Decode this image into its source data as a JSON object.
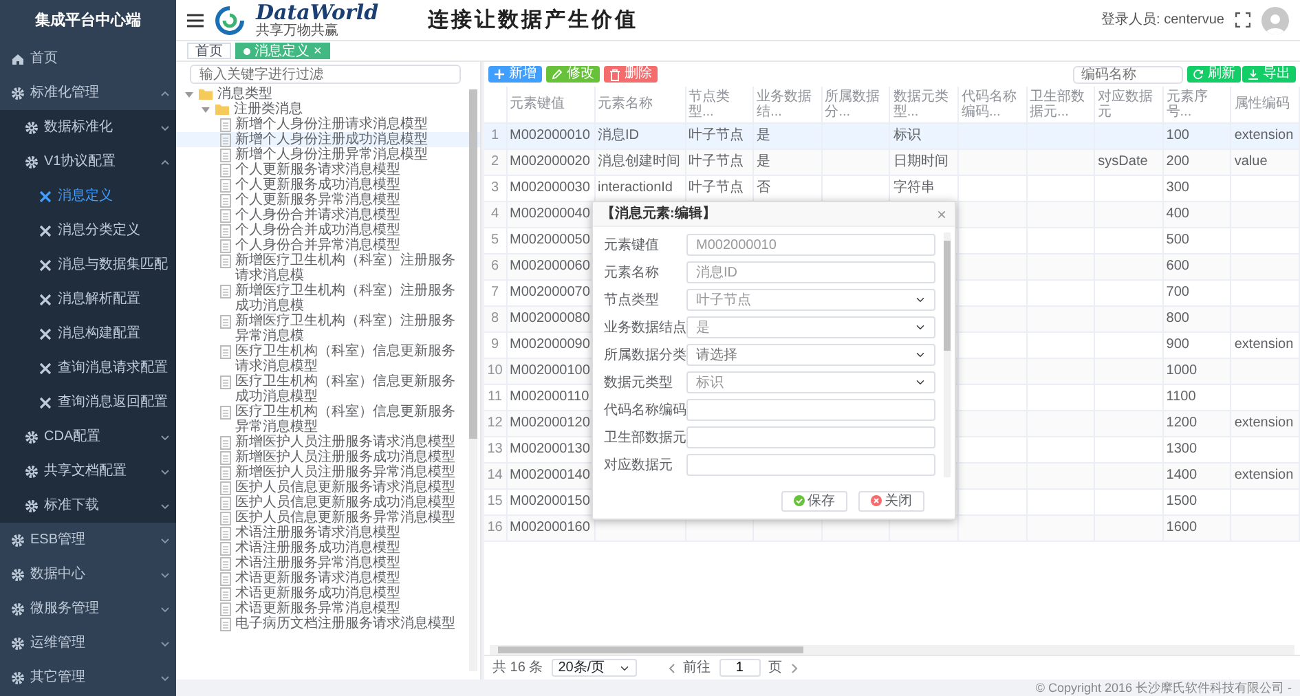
{
  "sidebar": {
    "title": "集成平台中心端",
    "items": [
      {
        "label": "首页",
        "kind": "home",
        "selected": false
      },
      {
        "label": "标准化管理",
        "kind": "group",
        "selected": false,
        "expanded": true,
        "children": [
          {
            "label": "数据标准化",
            "kind": "group",
            "selected": false,
            "expanded": false
          },
          {
            "label": "V1协议配置",
            "kind": "group",
            "selected": false,
            "expanded": true,
            "children": [
              {
                "label": "消息定义",
                "kind": "page",
                "selected": true
              },
              {
                "label": "消息分类定义",
                "kind": "page",
                "selected": false
              },
              {
                "label": "消息与数据集匹配",
                "kind": "page",
                "selected": false
              },
              {
                "label": "消息解析配置",
                "kind": "page",
                "selected": false
              },
              {
                "label": "消息构建配置",
                "kind": "page",
                "selected": false
              },
              {
                "label": "查询消息请求配置",
                "kind": "page",
                "selected": false
              },
              {
                "label": "查询消息返回配置",
                "kind": "page",
                "selected": false
              }
            ]
          },
          {
            "label": "CDA配置",
            "kind": "group",
            "selected": false,
            "expanded": false
          },
          {
            "label": "共享文档配置",
            "kind": "group",
            "selected": false,
            "expanded": false
          },
          {
            "label": "标准下载",
            "kind": "group",
            "selected": false,
            "expanded": false
          }
        ]
      },
      {
        "label": "ESB管理",
        "kind": "group",
        "selected": false,
        "expanded": false
      },
      {
        "label": "数据中心",
        "kind": "group",
        "selected": false,
        "expanded": false
      },
      {
        "label": "微服务管理",
        "kind": "group",
        "selected": false,
        "expanded": false
      },
      {
        "label": "运维管理",
        "kind": "group",
        "selected": false,
        "expanded": false
      },
      {
        "label": "其它管理",
        "kind": "group",
        "selected": false,
        "expanded": false
      }
    ]
  },
  "header": {
    "logo_title": "DataWorld",
    "logo_subtitle": "共享万物共赢",
    "slogan": "连接让数据产生价值",
    "user": "登录人员: centervue"
  },
  "tabs": [
    {
      "label": "首页",
      "selected": false
    },
    {
      "label": "消息定义",
      "selected": true,
      "close": "×"
    }
  ],
  "tree": {
    "placeholder": "输入关键字进行过滤",
    "nodes": [
      {
        "label": "消息类型",
        "kind": "folder",
        "expanded": true,
        "selected": false,
        "children": [
          {
            "label": "注册类消息",
            "kind": "folder",
            "expanded": true,
            "selected": false,
            "children": [
              {
                "label": "新增个人身份注册请求消息模型",
                "kind": "doc",
                "selected": false
              },
              {
                "label": "新增个人身份注册成功消息模型",
                "kind": "doc",
                "selected": true
              },
              {
                "label": "新增个人身份注册异常消息模型",
                "kind": "doc",
                "selected": false
              },
              {
                "label": "个人更新服务请求消息模型",
                "kind": "doc",
                "selected": false
              },
              {
                "label": "个人更新服务成功消息模型",
                "kind": "doc",
                "selected": false
              },
              {
                "label": "个人更新服务异常消息模型",
                "kind": "doc",
                "selected": false
              },
              {
                "label": "个人身份合并请求消息模型",
                "kind": "doc",
                "selected": false
              },
              {
                "label": "个人身份合并成功消息模型",
                "kind": "doc",
                "selected": false
              },
              {
                "label": "个人身份合并异常消息模型",
                "kind": "doc",
                "selected": false
              },
              {
                "label": "新增医疗卫生机构（科室）注册服务请求消息模",
                "kind": "doc",
                "selected": false
              },
              {
                "label": "新增医疗卫生机构（科室）注册服务成功消息模",
                "kind": "doc",
                "selected": false
              },
              {
                "label": "新增医疗卫生机构（科室）注册服务异常消息模",
                "kind": "doc",
                "selected": false
              },
              {
                "label": "医疗卫生机构（科室）信息更新服务请求消息模型",
                "kind": "doc",
                "selected": false
              },
              {
                "label": "医疗卫生机构（科室）信息更新服务成功消息模型",
                "kind": "doc",
                "selected": false
              },
              {
                "label": "医疗卫生机构（科室）信息更新服务异常消息模型",
                "kind": "doc",
                "selected": false
              },
              {
                "label": "新增医护人员注册服务请求消息模型",
                "kind": "doc",
                "selected": false
              },
              {
                "label": "新增医护人员注册服务成功消息模型",
                "kind": "doc",
                "selected": false
              },
              {
                "label": "新增医护人员注册服务异常消息模型",
                "kind": "doc",
                "selected": false
              },
              {
                "label": "医护人员信息更新服务请求消息模型",
                "kind": "doc",
                "selected": false
              },
              {
                "label": "医护人员信息更新服务成功消息模型",
                "kind": "doc",
                "selected": false
              },
              {
                "label": "医护人员信息更新服务异常消息模型",
                "kind": "doc",
                "selected": false
              },
              {
                "label": "术语注册服务请求消息模型",
                "kind": "doc",
                "selected": false
              },
              {
                "label": "术语注册服务成功消息模型",
                "kind": "doc",
                "selected": false
              },
              {
                "label": "术语注册服务异常消息模型",
                "kind": "doc",
                "selected": false
              },
              {
                "label": "术语更新服务请求消息模型",
                "kind": "doc",
                "selected": false
              },
              {
                "label": "术语更新服务成功消息模型",
                "kind": "doc",
                "selected": false
              },
              {
                "label": "术语更新服务异常消息模型",
                "kind": "doc",
                "selected": false
              },
              {
                "label": "电子病历文档注册服务请求消息模型",
                "kind": "doc",
                "selected": false
              }
            ]
          }
        ]
      }
    ]
  },
  "toolbar": {
    "buttons": [
      {
        "label": "新增",
        "kind": "add"
      },
      {
        "label": "修改",
        "kind": "edit"
      },
      {
        "label": "删除",
        "kind": "delete"
      }
    ],
    "search": {
      "placeholder": "编码名称"
    },
    "right_buttons": [
      {
        "label": "刷新",
        "kind": "refresh"
      },
      {
        "label": "导出",
        "kind": "export"
      }
    ]
  },
  "table": {
    "columns": [
      "元素键值",
      "元素名称",
      "节点类型...",
      "业务数据结...",
      "所属数据分...",
      "数据元类型...",
      "代码名称编码...",
      "卫生部数据元...",
      "对应数据元",
      "元素序号...",
      "属性编码"
    ],
    "rows": [
      {
        "selected": true,
        "no": "1",
        "key": "M002000010",
        "name": "消息ID",
        "node_type": "叶子节点",
        "business_node": "是",
        "element_type": "标识",
        "seq": "100",
        "attribute": "extension"
      },
      {
        "selected": false,
        "no": "2",
        "key": "M002000020",
        "name": "消息创建时间",
        "node_type": "叶子节点",
        "business_node": "是",
        "element_type": "日期时间",
        "mapped_element": "sysDate",
        "seq": "200",
        "attribute": "value"
      },
      {
        "selected": false,
        "no": "3",
        "key": "M002000030",
        "name": "interactionId",
        "node_type": "叶子节点",
        "business_node": "否",
        "element_type": "字符串",
        "seq": "300"
      },
      {
        "selected": false,
        "no": "4",
        "key": "M002000040",
        "seq": "400"
      },
      {
        "selected": false,
        "no": "5",
        "key": "M002000050",
        "seq": "500"
      },
      {
        "selected": false,
        "no": "6",
        "key": "M002000060",
        "seq": "600"
      },
      {
        "selected": false,
        "no": "7",
        "key": "M002000070",
        "seq": "700"
      },
      {
        "selected": false,
        "no": "8",
        "key": "M002000080",
        "seq": "800"
      },
      {
        "selected": false,
        "no": "9",
        "key": "M002000090",
        "seq": "900",
        "attribute": "extension"
      },
      {
        "selected": false,
        "no": "10",
        "key": "M002000100",
        "seq": "1000"
      },
      {
        "selected": false,
        "no": "11",
        "key": "M002000110",
        "seq": "1100"
      },
      {
        "selected": false,
        "no": "12",
        "key": "M002000120",
        "seq": "1200",
        "attribute": "extension"
      },
      {
        "selected": false,
        "no": "13",
        "key": "M002000130",
        "seq": "1300"
      },
      {
        "selected": false,
        "no": "14",
        "key": "M002000140",
        "seq": "1400",
        "attribute": "extension"
      },
      {
        "selected": false,
        "no": "15",
        "key": "M002000150",
        "seq": "1500"
      },
      {
        "selected": false,
        "no": "16",
        "key": "M002000160",
        "seq": "1600"
      }
    ]
  },
  "dialog": {
    "title": "【消息元素:编辑】",
    "close": "×",
    "fields": [
      {
        "label": "元素键值",
        "kind": "input",
        "value": "M002000010"
      },
      {
        "label": "元素名称",
        "kind": "input",
        "value": "消息ID"
      },
      {
        "label": "节点类型",
        "kind": "select",
        "value": "叶子节点"
      },
      {
        "label": "业务数据结点",
        "kind": "select",
        "value": "是"
      },
      {
        "label": "所属数据分类",
        "kind": "select",
        "placeholder": "请选择"
      },
      {
        "label": "数据元类型",
        "kind": "select",
        "value": "标识"
      },
      {
        "label": "代码名称编码",
        "kind": "input"
      },
      {
        "label": "卫生部数据元",
        "kind": "input"
      },
      {
        "label": "对应数据元",
        "kind": "input"
      }
    ],
    "buttons": [
      {
        "label": "保存",
        "kind": "save"
      },
      {
        "label": "关闭",
        "kind": "close"
      }
    ]
  },
  "pager": {
    "total": "共 16 条",
    "page_size": "20条/页",
    "goto_label": "前往",
    "page": "1",
    "page_suffix": "页"
  },
  "footer": "© Copyright 2016 长沙摩氏软件科技有限公司 -"
}
